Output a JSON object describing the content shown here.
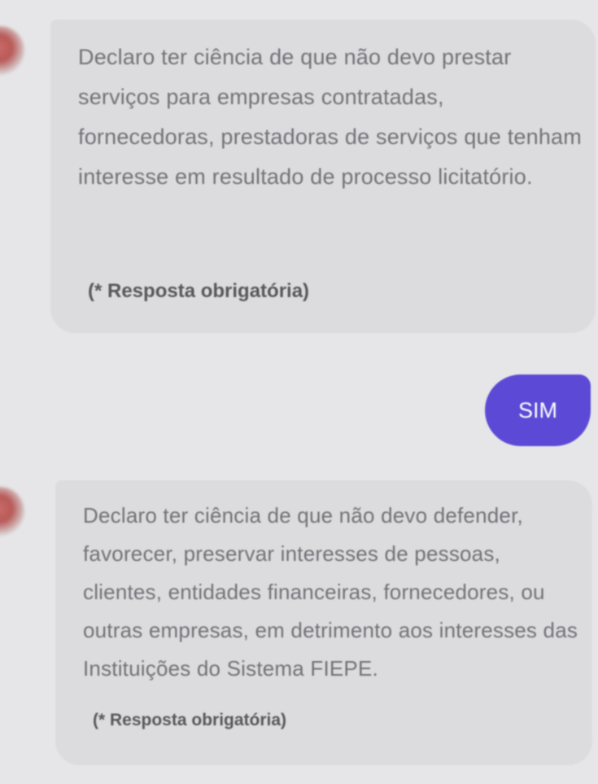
{
  "messages": [
    {
      "text": "Declaro ter ciência de que não devo prestar serviços para empresas contratadas, fornecedoras, prestadoras de serviços que tenham interesse em resultado de processo licitatório.",
      "required_note": "(* Resposta obrigatória)"
    },
    {
      "text": "Declaro ter ciência de que não devo defender, favorecer, preservar interesses de pessoas, clientes, entidades financeiras, fornecedores, ou outras empresas, em detrimento aos interesses das Instituições do Sistema FIEPE.",
      "required_note": "(* Resposta obrigatória)"
    }
  ],
  "answer": {
    "label": "SIM"
  },
  "colors": {
    "answer_bubble": "#5c4ad6",
    "question_bubble": "#dcdcdf",
    "background": "#e6e6e8"
  }
}
